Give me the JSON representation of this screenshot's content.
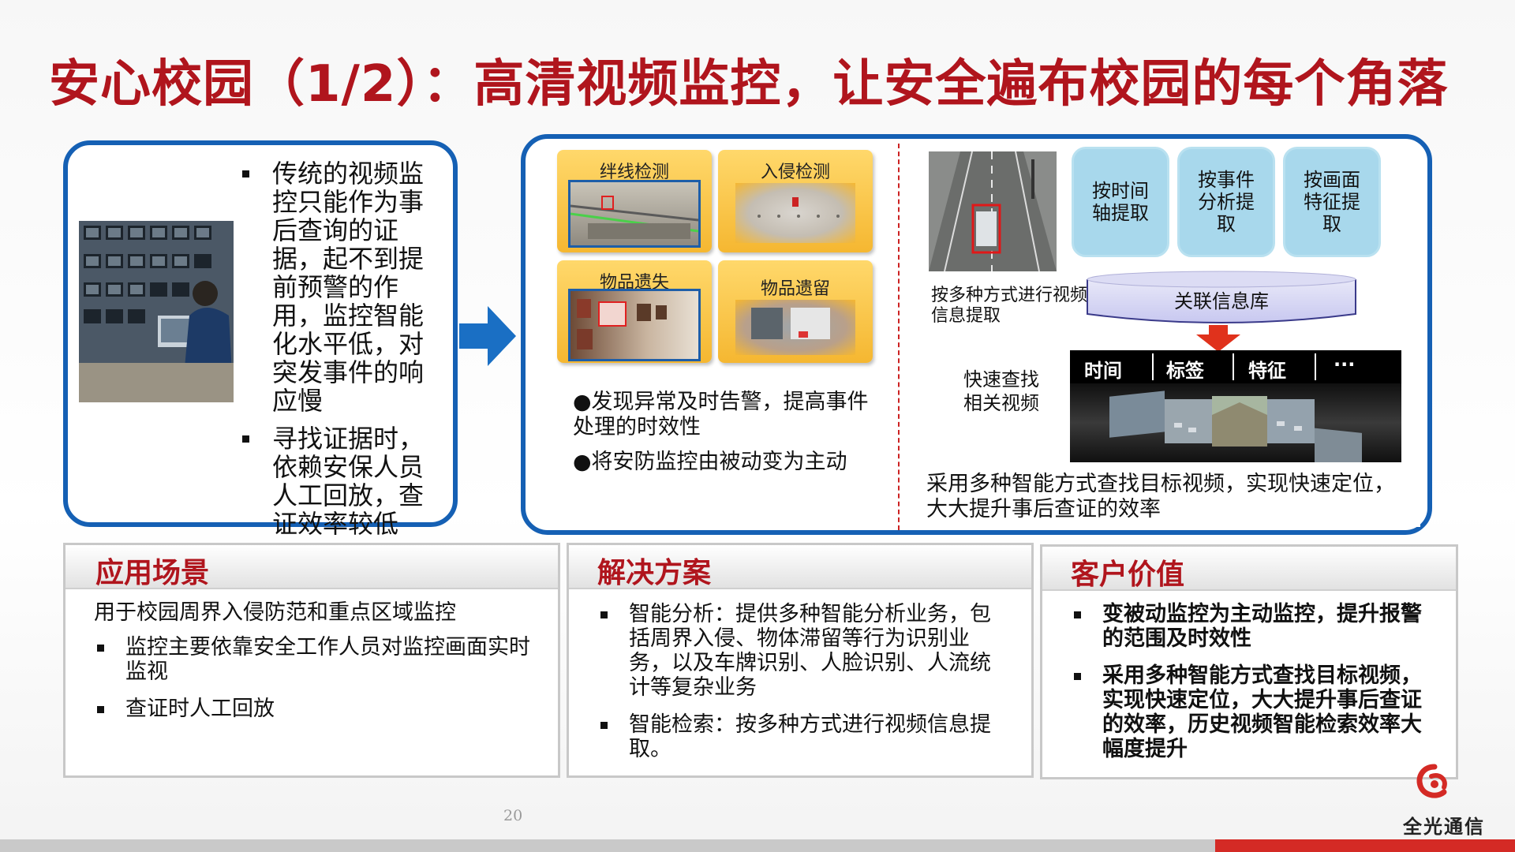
{
  "title": "安心校园（1/2）：高清视频监控，让安全遍布校园的每个角落",
  "left_panel": {
    "bullets": [
      "传统的视频监控只能作为事后查询的证据，起不到提前预警的作用，监控智能化水平低，对突发事件的响应慢",
      "寻找证据时，依赖安保人员人工回放，查证效率较低"
    ]
  },
  "detect_tiles": [
    "绊线检测",
    "入侵检测",
    "物品遗失",
    "物品遗留"
  ],
  "detect_notes": [
    "●发现异常及时告警，提高事件处理的时效性",
    "●将安防监控由被动变为主动"
  ],
  "retrieval": {
    "extract_caption": "按多种方式进行视频信息提取",
    "methods": [
      "按时间轴提取",
      "按事件分析提取",
      "按画面特征提取"
    ],
    "db_label": "关联信息库",
    "quick_search": "快速查找相关视频",
    "tags": [
      "时间",
      "标签",
      "特征",
      "···"
    ],
    "summary": "采用多种智能方式查找目标视频，实现快速定位，大大提升事后查证的效率"
  },
  "scenario": {
    "title": "应用场景",
    "intro": "用于校园周界入侵防范和重点区域监控",
    "bullets": [
      "监控主要依靠安全工作人员对监控画面实时监视",
      "查证时人工回放"
    ]
  },
  "solution": {
    "title": "解决方案",
    "bullets": [
      "智能分析：提供多种智能分析业务，包括周界入侵、物体滞留等行为识别业务，以及车牌识别、人脸识别、人流统计等复杂业务",
      "智能检索：按多种方式进行视频信息提取。"
    ]
  },
  "value": {
    "title": "客户价值",
    "bullets": [
      "变被动监控为主动监控，提升报警的范围及时效性",
      "采用多种智能方式查找目标视频，实现快速定位，大大提升事后查证的效率，历史视频智能检索效率大幅度提升"
    ]
  },
  "page_number": "20",
  "logo_text": "全光通信",
  "colors": {
    "title_red": "#b0151d",
    "panel_blue": "#1560b4",
    "tile_yellow": "#f5b731",
    "pill_blue": "#a8d8ec"
  }
}
